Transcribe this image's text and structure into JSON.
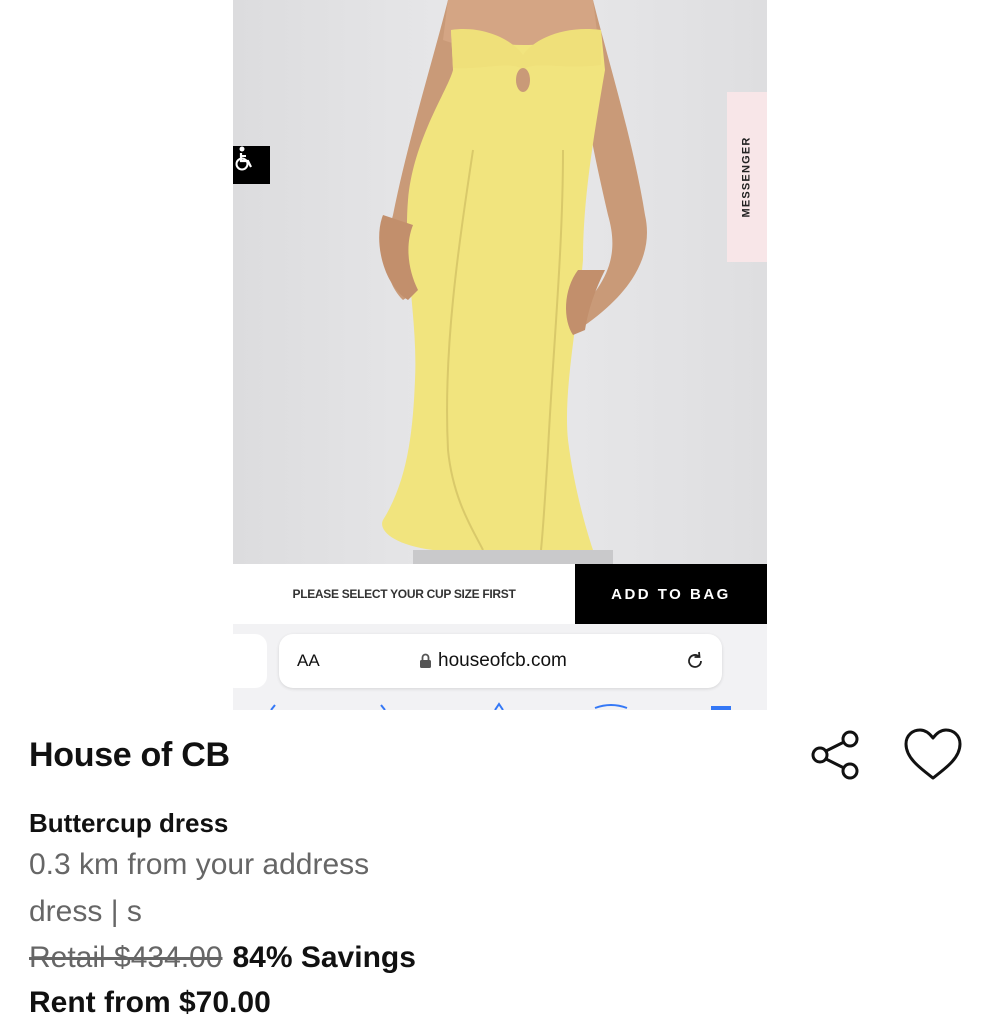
{
  "embedded_screenshot": {
    "messenger_tab": "MESSENGER",
    "cup_size_prompt": "PLEASE SELECT YOUR CUP SIZE FIRST",
    "add_to_bag": "ADD TO BAG",
    "browser": {
      "text_size_label": "AA",
      "url": "houseofcb.com"
    },
    "dress_color": "#f1e47e"
  },
  "listing": {
    "brand": "House of CB",
    "title": "Buttercup dress",
    "distance": "0.3 km from your address",
    "category_size": "dress | s",
    "retail_price": "Retail $434.00",
    "savings": "84% Savings",
    "rent_from": "Rent from $70.00"
  },
  "icons": [
    "wheelchair-icon",
    "lock-icon",
    "reload-icon",
    "share-icon",
    "heart-icon"
  ]
}
